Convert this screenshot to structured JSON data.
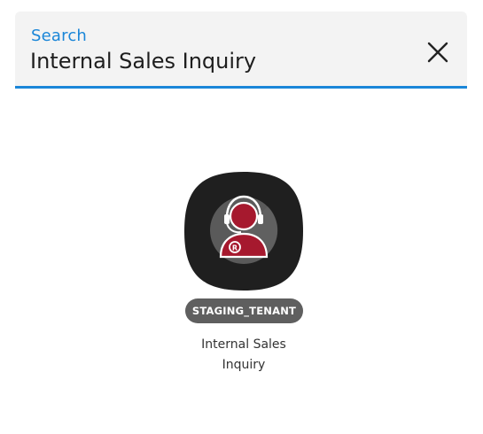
{
  "search": {
    "label": "Search",
    "value": "Internal Sales Inquiry"
  },
  "results": [
    {
      "icon": "support-agent-icon",
      "tenant_badge": "STAGING_TENANT",
      "name": "Internal Sales Inquiry"
    }
  ],
  "colors": {
    "accent": "#1a86d8",
    "icon_background": "#1f1f1f",
    "agent_red": "#a6192e",
    "badge_background": "#5f5f5f"
  }
}
